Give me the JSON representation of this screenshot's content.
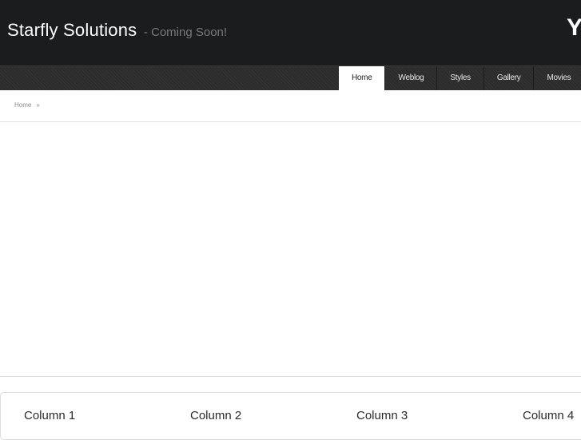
{
  "header": {
    "site_name": "Starfly Solutions",
    "tagline": "- Coming Soon!",
    "right_glyph": "Y"
  },
  "nav": {
    "items": [
      {
        "label": "Home",
        "active": true
      },
      {
        "label": "Weblog",
        "active": false
      },
      {
        "label": "Styles",
        "active": false
      },
      {
        "label": "Gallery",
        "active": false
      },
      {
        "label": "Movies",
        "active": false
      }
    ]
  },
  "breadcrumb": {
    "home": "Home",
    "separator": "»"
  },
  "footer": {
    "columns": [
      {
        "title": "Column 1"
      },
      {
        "title": "Column 2"
      },
      {
        "title": "Column 3"
      },
      {
        "title": "Column 4"
      }
    ]
  },
  "colors": {
    "header_bg": "#1b1c1e",
    "nav_bg": "#2c2c2c",
    "tagline": "#7a7a7a",
    "active_tab_bg": "#ffffff"
  }
}
